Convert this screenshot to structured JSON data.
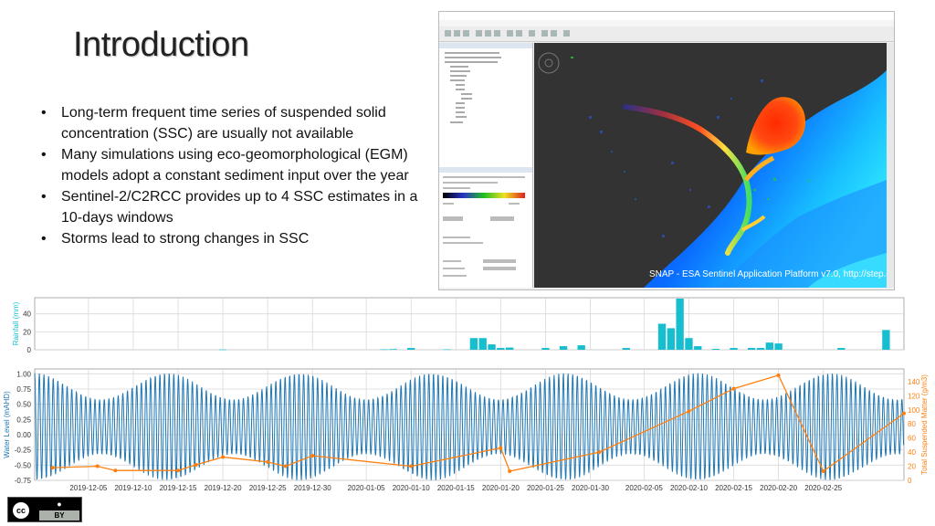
{
  "slide": {
    "title": "Introduction",
    "bullets": [
      "Long-term frequent time series of suspended solid concentration (SSC) are usually not available",
      "Many simulations using eco-geomorphological (EGM) models adopt a constant sediment input over the year",
      "Sentinel-2/C2RCC provides up to 4 SSC estimates in a 10-days windows",
      "Storms lead to strong changes in SSC"
    ],
    "bullet_glyph": "•"
  },
  "screenshot": {
    "caption": "SNAP - ESA Sentinel Application Platform v7.0, http://step.esa.int"
  },
  "license": {
    "badge": "cc",
    "label": "BY"
  },
  "colors": {
    "bar": "#17becf",
    "water_line": "#1f77b4",
    "ssc_line": "#ff7f0e",
    "grid": "#d9d9d9",
    "map_bg": "#333333"
  },
  "chart_data": [
    {
      "type": "bar",
      "ylabel": "Rainfall (mm)",
      "yticks": [
        0,
        20,
        40
      ],
      "ylim": [
        0,
        58
      ],
      "xlim": [
        "2019-11-29",
        "2020-03-05"
      ],
      "grid": true,
      "bars": [
        {
          "x": "2019-12-20",
          "y": 0.3
        },
        {
          "x": "2020-01-07",
          "y": 0.5
        },
        {
          "x": "2020-01-08",
          "y": 0.8
        },
        {
          "x": "2020-01-10",
          "y": 2
        },
        {
          "x": "2020-01-14",
          "y": 0.5
        },
        {
          "x": "2020-01-17",
          "y": 13
        },
        {
          "x": "2020-01-18",
          "y": 13
        },
        {
          "x": "2020-01-19",
          "y": 6
        },
        {
          "x": "2020-01-20",
          "y": 2
        },
        {
          "x": "2020-01-21",
          "y": 2.5
        },
        {
          "x": "2020-01-25",
          "y": 2
        },
        {
          "x": "2020-01-27",
          "y": 4
        },
        {
          "x": "2020-01-29",
          "y": 5
        },
        {
          "x": "2020-02-03",
          "y": 2
        },
        {
          "x": "2020-02-07",
          "y": 29
        },
        {
          "x": "2020-02-08",
          "y": 24
        },
        {
          "x": "2020-02-09",
          "y": 57
        },
        {
          "x": "2020-02-10",
          "y": 13
        },
        {
          "x": "2020-02-11",
          "y": 4
        },
        {
          "x": "2020-02-13",
          "y": 1
        },
        {
          "x": "2020-02-15",
          "y": 2
        },
        {
          "x": "2020-02-17",
          "y": 2
        },
        {
          "x": "2020-02-18",
          "y": 2
        },
        {
          "x": "2020-02-19",
          "y": 8
        },
        {
          "x": "2020-02-20",
          "y": 7
        },
        {
          "x": "2020-02-27",
          "y": 2
        },
        {
          "x": "2020-03-03",
          "y": 22
        }
      ]
    },
    {
      "type": "line",
      "xlabel": "",
      "ylabel": "Water Level (mAHD)",
      "y2label": "Total Suspended Matter (g/m3)",
      "xlim": [
        "2019-11-29",
        "2020-03-05"
      ],
      "ylim": [
        -0.75,
        1.08
      ],
      "y2lim": [
        0,
        158
      ],
      "yticks": [
        -0.75,
        -0.5,
        -0.25,
        0.0,
        0.25,
        0.5,
        0.75,
        1.0
      ],
      "yticklabels": [
        "-0.75",
        "-0.50",
        "-0.25",
        "0.00",
        "0.25",
        "0.50",
        "0.75",
        "1.00"
      ],
      "y2ticks": [
        0,
        20,
        40,
        60,
        80,
        100,
        120,
        140
      ],
      "xticks": [
        "2019-12-05",
        "2019-12-10",
        "2019-12-15",
        "2019-12-20",
        "2019-12-25",
        "2019-12-30",
        "2020-01-05",
        "2020-01-10",
        "2020-01-15",
        "2020-01-20",
        "2020-01-25",
        "2020-01-30",
        "2020-02-05",
        "2020-02-10",
        "2020-02-15",
        "2020-02-20",
        "2020-02-25"
      ],
      "grid": true,
      "series": [
        {
          "axis": "left",
          "kind": "tide",
          "tide_mean_level": 0.13,
          "tide_amplitude_range": [
            0.45,
            0.88
          ],
          "tide_period_hours": 12.42,
          "spring_neap_cycle_days": 14.8
        },
        {
          "axis": "right",
          "kind": "points",
          "points": [
            {
              "x": "2019-12-01",
              "y": 18
            },
            {
              "x": "2019-12-06",
              "y": 20
            },
            {
              "x": "2019-12-08",
              "y": 14
            },
            {
              "x": "2019-12-15",
              "y": 14
            },
            {
              "x": "2019-12-17",
              "y": 22
            },
            {
              "x": "2019-12-20",
              "y": 33
            },
            {
              "x": "2019-12-25",
              "y": 26
            },
            {
              "x": "2019-12-27",
              "y": 20
            },
            {
              "x": "2019-12-30",
              "y": 35
            },
            {
              "x": "2020-01-10",
              "y": 20
            },
            {
              "x": "2020-01-20",
              "y": 46
            },
            {
              "x": "2020-01-21",
              "y": 13
            },
            {
              "x": "2020-01-31",
              "y": 40
            },
            {
              "x": "2020-02-10",
              "y": 98
            },
            {
              "x": "2020-02-15",
              "y": 130
            },
            {
              "x": "2020-02-20",
              "y": 149
            },
            {
              "x": "2020-02-25",
              "y": 13
            },
            {
              "x": "2020-03-05",
              "y": 95
            }
          ]
        }
      ]
    }
  ]
}
